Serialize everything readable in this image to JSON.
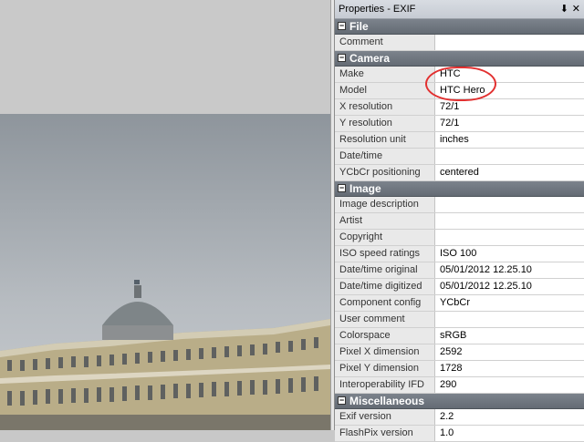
{
  "panel": {
    "title": "Properties - EXIF",
    "pin_icon": "pin-icon",
    "close_icon": "close-icon"
  },
  "sections": [
    {
      "name": "File",
      "rows": [
        {
          "key": "Comment",
          "value": ""
        }
      ]
    },
    {
      "name": "Camera",
      "rows": [
        {
          "key": "Make",
          "value": "HTC"
        },
        {
          "key": "Model",
          "value": "HTC Hero"
        },
        {
          "key": "X resolution",
          "value": "72/1"
        },
        {
          "key": "Y resolution",
          "value": "72/1"
        },
        {
          "key": "Resolution unit",
          "value": "inches"
        },
        {
          "key": "Date/time",
          "value": ""
        },
        {
          "key": "YCbCr positioning",
          "value": "centered"
        }
      ]
    },
    {
      "name": "Image",
      "rows": [
        {
          "key": "Image description",
          "value": ""
        },
        {
          "key": "Artist",
          "value": ""
        },
        {
          "key": "Copyright",
          "value": ""
        },
        {
          "key": "ISO speed ratings",
          "value": "ISO 100"
        },
        {
          "key": "Date/time original",
          "value": "05/01/2012 12.25.10"
        },
        {
          "key": "Date/time digitized",
          "value": "05/01/2012 12.25.10"
        },
        {
          "key": "Component config",
          "value": "YCbCr"
        },
        {
          "key": "User comment",
          "value": ""
        },
        {
          "key": "Colorspace",
          "value": "sRGB"
        },
        {
          "key": "Pixel X dimension",
          "value": "2592"
        },
        {
          "key": "Pixel Y dimension",
          "value": "1728"
        },
        {
          "key": "Interoperability IFD",
          "value": "290"
        }
      ]
    },
    {
      "name": "Miscellaneous",
      "rows": [
        {
          "key": "Exif version",
          "value": "2.2"
        },
        {
          "key": "FlashPix version",
          "value": "1.0"
        }
      ]
    }
  ],
  "annotation_color": "#e23030"
}
